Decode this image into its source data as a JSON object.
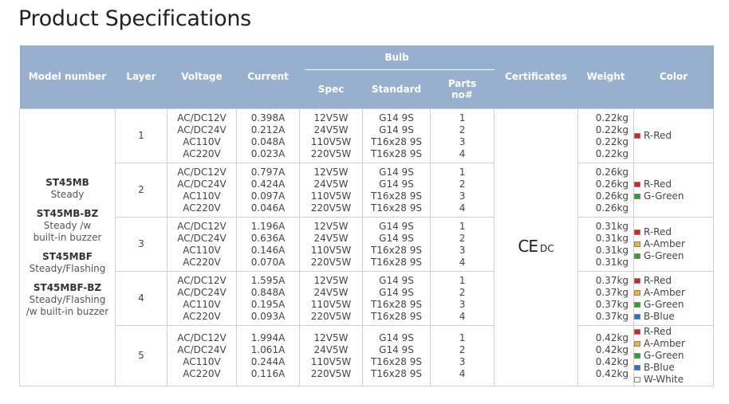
{
  "page": {
    "title": "Product Specifications"
  },
  "table": {
    "headers": {
      "model": "Model number",
      "layer": "Layer",
      "voltage": "Voltage",
      "current": "Current",
      "bulb": "Bulb",
      "spec": "Spec",
      "standard": "Standard",
      "parts_line1": "Parts",
      "parts_line2": "no#",
      "certificates": "Certificates",
      "weight": "Weight",
      "color": "Color"
    },
    "models": [
      {
        "name": "ST45MB",
        "desc": [
          "Steady"
        ]
      },
      {
        "name": "ST45MB-BZ",
        "desc": [
          "Steady /w",
          "built-in buzzer"
        ]
      },
      {
        "name": "ST45MBF",
        "desc": [
          "Steady/Flashing"
        ]
      },
      {
        "name": "ST45MBF-BZ",
        "desc": [
          "Steady/Flashing",
          "/w built-in buzzer"
        ]
      }
    ],
    "certificate": {
      "mark": "CE",
      "suffix": "DC"
    },
    "rows": [
      {
        "layer": "1",
        "voltage": [
          "AC/DC12V",
          "AC/DC24V",
          "AC110V",
          "AC220V"
        ],
        "current": [
          "0.398A",
          "0.212A",
          "0.048A",
          "0.023A"
        ],
        "spec": [
          "12V5W",
          "24V5W",
          "110V5W",
          "220V5W"
        ],
        "standard": [
          "G14 9S",
          "G14 9S",
          "T16x28 9S",
          "T16x28 9S"
        ],
        "parts": [
          "1",
          "2",
          "3",
          "4"
        ],
        "weight": [
          "0.22kg",
          "0.22kg",
          "0.22kg",
          "0.22kg"
        ],
        "colors": [
          {
            "label": "R-Red",
            "hex": "#e02020"
          }
        ]
      },
      {
        "layer": "2",
        "voltage": [
          "AC/DC12V",
          "AC/DC24V",
          "AC110V",
          "AC220V"
        ],
        "current": [
          "0.797A",
          "0.424A",
          "0.097A",
          "0.046A"
        ],
        "spec": [
          "12V5W",
          "24V5W",
          "110V5W",
          "220V5W"
        ],
        "standard": [
          "G14 9S",
          "G14 9S",
          "T16x28 9S",
          "T16x28 9S"
        ],
        "parts": [
          "1",
          "2",
          "3",
          "4"
        ],
        "weight": [
          "0.26kg",
          "0.26kg",
          "0.26kg",
          "0.26kg"
        ],
        "colors": [
          {
            "label": "R-Red",
            "hex": "#e02020"
          },
          {
            "label": "G-Green",
            "hex": "#2aa52a"
          }
        ]
      },
      {
        "layer": "3",
        "voltage": [
          "AC/DC12V",
          "AC/DC24V",
          "AC110V",
          "AC220V"
        ],
        "current": [
          "1.196A",
          "0.636A",
          "0.146A",
          "0.070A"
        ],
        "spec": [
          "12V5W",
          "24V5W",
          "110V5W",
          "220V5W"
        ],
        "standard": [
          "G14 9S",
          "G14 9S",
          "T16x28 9S",
          "T16x28 9S"
        ],
        "parts": [
          "1",
          "2",
          "3",
          "4"
        ],
        "weight": [
          "0.31kg",
          "0.31kg",
          "0.31kg",
          "0.31kg"
        ],
        "colors": [
          {
            "label": "R-Red",
            "hex": "#e02020"
          },
          {
            "label": "A-Amber",
            "hex": "#f2b035"
          },
          {
            "label": "G-Green",
            "hex": "#2aa52a"
          }
        ]
      },
      {
        "layer": "4",
        "voltage": [
          "AC/DC12V",
          "AC/DC24V",
          "AC110V",
          "AC220V"
        ],
        "current": [
          "1.595A",
          "0.848A",
          "0.195A",
          "0.093A"
        ],
        "spec": [
          "12V5W",
          "24V5W",
          "110V5W",
          "220V5W"
        ],
        "standard": [
          "G14 9S",
          "G14 9S",
          "T16x28 9S",
          "T16x28 9S"
        ],
        "parts": [
          "1",
          "2",
          "3",
          "4"
        ],
        "weight": [
          "0.37kg",
          "0.37kg",
          "0.37kg",
          "0.37kg"
        ],
        "colors": [
          {
            "label": "R-Red",
            "hex": "#e02020"
          },
          {
            "label": "A-Amber",
            "hex": "#f2b035"
          },
          {
            "label": "G-Green",
            "hex": "#2aa52a"
          },
          {
            "label": "B-Blue",
            "hex": "#2a6fd6"
          }
        ]
      },
      {
        "layer": "5",
        "voltage": [
          "AC/DC12V",
          "AC/DC24V",
          "AC110V",
          "AC220V"
        ],
        "current": [
          "1.994A",
          "1.061A",
          "0.244A",
          "0.116A"
        ],
        "spec": [
          "12V5W",
          "24V5W",
          "110V5W",
          "220V5W"
        ],
        "standard": [
          "G14 9S",
          "G14 9S",
          "T16x28 9S",
          "T16x28 9S"
        ],
        "parts": [
          "1",
          "2",
          "3",
          "4"
        ],
        "weight": [
          "0.42kg",
          "0.42kg",
          "0.42kg",
          "0.42kg"
        ],
        "colors": [
          {
            "label": "R-Red",
            "hex": "#e02020"
          },
          {
            "label": "A-Amber",
            "hex": "#f2b035"
          },
          {
            "label": "G-Green",
            "hex": "#2aa52a"
          },
          {
            "label": "B-Blue",
            "hex": "#2a6fd6"
          },
          {
            "label": "W-White",
            "hex": "#f4f4f4"
          }
        ]
      }
    ]
  }
}
